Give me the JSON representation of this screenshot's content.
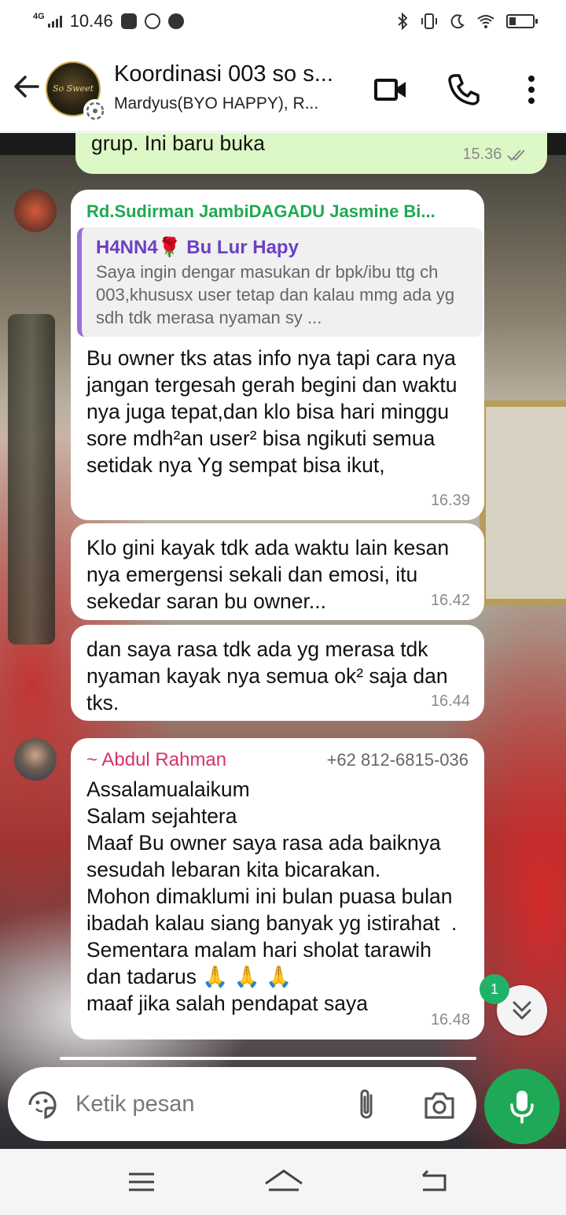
{
  "status_bar": {
    "network": "4G",
    "time": "10.46"
  },
  "header": {
    "title": "Koordinasi 003 so s...",
    "subtitle": "Mardyus(BYO HAPPY), R...",
    "avatar_text": "So Sweet"
  },
  "messages": [
    {
      "text": "grup. Ini baru buka",
      "time": "15.36",
      "direction": "out"
    },
    {
      "sender": "Rd.Sudirman JambiDAGADU Jasmine Bi...",
      "sender_color": "#1fa855",
      "quote": {
        "name": "H4NN4🌹 Bu Lur Hapy",
        "text": "Saya ingin dengar masukan dr  bpk/ibu ttg ch 003,khususx user tetap dan kalau mmg ada yg sdh tdk merasa nyaman sy ..."
      },
      "text": "Bu owner tks atas info nya tapi cara nya jangan tergesah gerah begini dan waktu nya juga tepat,dan klo bisa hari minggu sore mdh²an user² bisa ngikuti semua setidak nya Yg sempat bisa ikut,",
      "time": "16.39"
    },
    {
      "text": "Klo gini kayak tdk ada waktu lain kesan nya emergensi sekali dan emosi, itu sekedar saran bu owner...",
      "time": "16.42"
    },
    {
      "text": "dan saya rasa tdk ada yg merasa tdk nyaman kayak nya semua ok² saja dan tks.",
      "time": "16.44"
    },
    {
      "sender": "~ Abdul Rahman",
      "sender_color": "#d6336c",
      "phone": "+62 812-6815-036",
      "text": "Assalamualaikum\nSalam sejahtera\nMaaf Bu owner saya rasa ada baiknya sesudah lebaran kita bicarakan.\nMohon dimaklumi ini bulan puasa bulan ibadah kalau siang banyak yg istirahat  . Sementara malam hari sholat tarawih dan tadarus 🙏 🙏 🙏\nmaaf jika salah pendapat saya",
      "time": "16.48"
    }
  ],
  "unread_count": "1",
  "composer": {
    "placeholder": "Ketik pesan"
  },
  "colors": {
    "accent": "#1fa855",
    "bubble_out": "#dcf8c6",
    "bubble_in": "#ffffff"
  }
}
